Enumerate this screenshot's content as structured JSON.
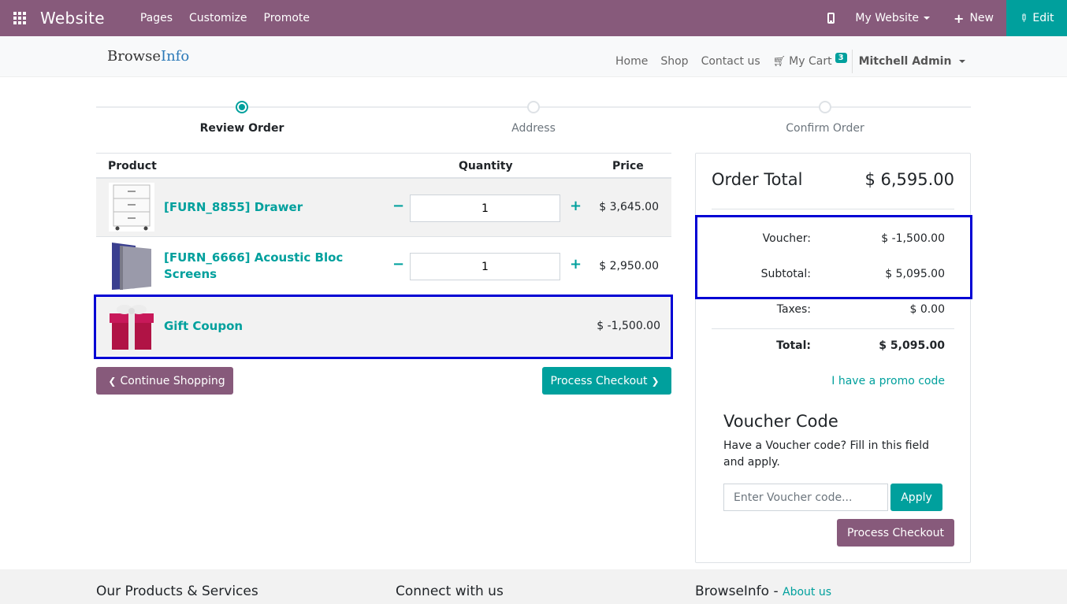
{
  "admin": {
    "brand": "Website",
    "menu": [
      "Pages",
      "Customize",
      "Promote"
    ],
    "site": "My Website",
    "new_label": "New",
    "edit_label": "Edit",
    "color": "#875a7b",
    "accent": "#00a09d"
  },
  "header": {
    "logo_a": "Browse",
    "logo_b": "Info",
    "nav": [
      "Home",
      "Shop",
      "Contact us"
    ],
    "cart_label": "My Cart",
    "cart_count": "3",
    "user": "Mitchell Admin"
  },
  "steps": {
    "s1": "Review Order",
    "s2": "Address",
    "s3": "Confirm Order",
    "active": 1
  },
  "table": {
    "col_product": "Product",
    "col_quantity": "Quantity",
    "col_price": "Price",
    "rows": [
      {
        "name": "[FURN_8855] Drawer",
        "qty": "1",
        "price": "$ 3,645.00",
        "image": "drawer-icon"
      },
      {
        "name_l1": "[FURN_6666] Acoustic Bloc",
        "name_l2": "Screens",
        "qty": "1",
        "price": "$ 2,950.00",
        "image": "screens-icon"
      },
      {
        "name": "Gift Coupon",
        "price": "$ -1,500.00",
        "image": "gift-icon"
      }
    ]
  },
  "buttons": {
    "continue": "Continue Shopping",
    "checkout": "Process Checkout"
  },
  "summary": {
    "order_total_label": "Order Total",
    "order_total": "$ 6,595.00",
    "voucher_label": "Voucher:",
    "voucher": "$ -1,500.00",
    "subtotal_label": "Subtotal:",
    "subtotal": "$ 5,095.00",
    "taxes_label": "Taxes:",
    "taxes": "$ 0.00",
    "total_label": "Total:",
    "total": "$ 5,095.00",
    "promo_link": "I have a promo code"
  },
  "voucher": {
    "title": "Voucher Code",
    "desc": "Have a Voucher code? Fill in this field and apply.",
    "placeholder": "Enter Voucher code...",
    "apply": "Apply",
    "checkout": "Process Checkout"
  },
  "footer": {
    "col1": "Our Products & Services",
    "col2": "Connect with us",
    "col3": "BrowseInfo",
    "sep": " - ",
    "about": "About us"
  }
}
